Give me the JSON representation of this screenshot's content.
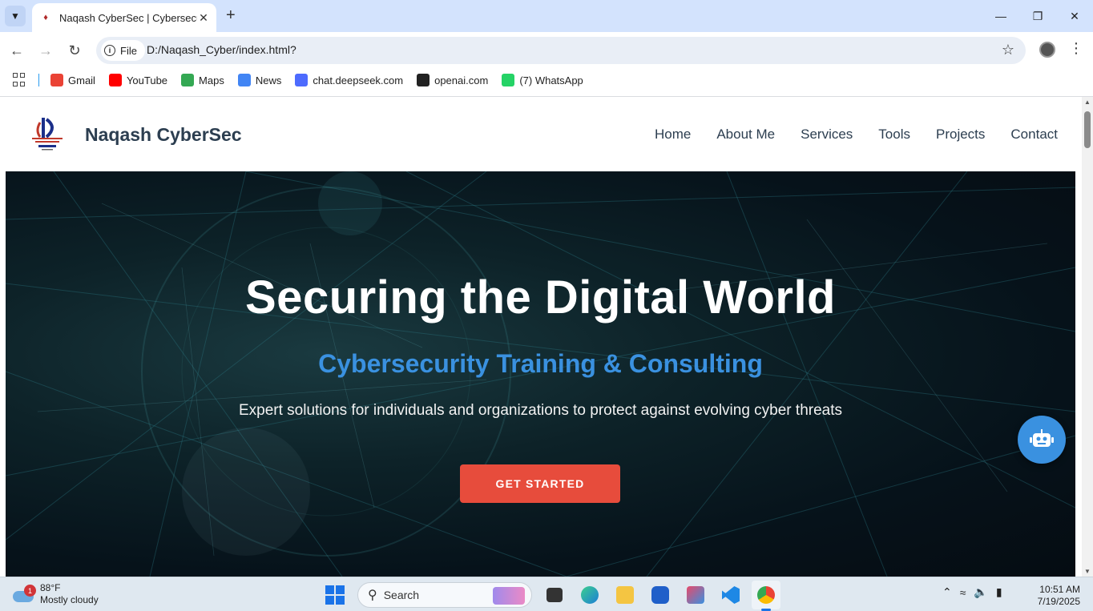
{
  "browser": {
    "tab_title": "Naqash CyberSec | Cybersecurit",
    "url_scheme_label": "File",
    "url": "D:/Naqash_Cyber/index.html?",
    "bookmarks": [
      {
        "label": "Gmail",
        "icon": "gmail-icon",
        "color": "#ea4335"
      },
      {
        "label": "YouTube",
        "icon": "youtube-icon",
        "color": "#ff0000"
      },
      {
        "label": "Maps",
        "icon": "maps-icon",
        "color": "#34a853"
      },
      {
        "label": "News",
        "icon": "news-icon",
        "color": "#4285f4"
      },
      {
        "label": "chat.deepseek.com",
        "icon": "deepseek-icon",
        "color": "#4d6bfe"
      },
      {
        "label": "openai.com",
        "icon": "openai-icon",
        "color": "#222222"
      },
      {
        "label": "(7) WhatsApp",
        "icon": "whatsapp-icon",
        "color": "#25d366"
      }
    ]
  },
  "site": {
    "brand": "Naqash CyberSec",
    "nav": [
      "Home",
      "About Me",
      "Services",
      "Tools",
      "Projects",
      "Contact"
    ],
    "hero": {
      "title": "Securing the Digital World",
      "subtitle": "Cybersecurity Training & Consulting",
      "text": "Expert solutions for individuals and organizations to protect against evolving cyber threats",
      "cta": "GET STARTED"
    },
    "colors": {
      "accent": "#3a91e0",
      "cta": "#e74c3c",
      "heading": "#2c3e50"
    }
  },
  "taskbar": {
    "weather_temp": "88°F",
    "weather_desc": "Mostly cloudy",
    "weather_badge": "1",
    "search_placeholder": "Search",
    "time": "10:51 AM",
    "date": "7/19/2025"
  }
}
